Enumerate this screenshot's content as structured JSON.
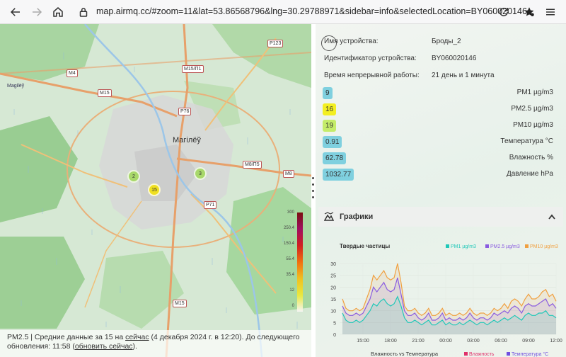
{
  "browser": {
    "url": "map.airmq.cc/#zoom=11&lat=53.86568796&lng=30.29788971&sidebar=info&selectedLocation=BY060020146",
    "icons": [
      "back-arrow-icon",
      "forward-arrow-icon",
      "home-icon",
      "lock-icon",
      "reload-icon",
      "bookmark-star-icon",
      "menu-icon"
    ]
  },
  "map": {
    "city": "Магілёў",
    "road_labels": [
      "M4",
      "M15",
      "M15/П1",
      "P123",
      "P76",
      "M8/П5",
      "M8",
      "P71",
      "M15"
    ],
    "poi_label": "Magilёў",
    "markers": [
      {
        "value": "2",
        "color": "#a8d86a"
      },
      {
        "value": "3",
        "color": "#a8d86a"
      },
      {
        "value": "15",
        "color": "#f0e020"
      }
    ],
    "scale_ticks": [
      "300",
      "250.4",
      "150.4",
      "55.4",
      "35.4",
      "12",
      "0"
    ],
    "footer": {
      "text1": "PM2.5 | Средние данные за 15 на ",
      "link1": "сейчас",
      "text2": " (4 декабря 2024 г. в 12:20). До следующего",
      "text3": "обновления: 11:58 (",
      "link2": "обновить сейчас",
      "text4": ")."
    }
  },
  "sidebar": {
    "info": [
      {
        "label": "Имя устройства:",
        "value": "Броды_2"
      },
      {
        "label": "Идентификатор устройства:",
        "value": "BY060020146"
      },
      {
        "label": "Время непрерывной работы:",
        "value": "21 день и 1 минута"
      }
    ],
    "measurements": [
      {
        "value": "9",
        "label": "PM1 µg/m3",
        "color": "#7fd0df"
      },
      {
        "value": "16",
        "label": "PM2.5 µg/m3",
        "color": "#f3ef22"
      },
      {
        "value": "19",
        "label": "PM10 µg/m3",
        "color": "#c4ec6a"
      },
      {
        "value": "0.91",
        "label": "Температура °C",
        "color": "#7fd0df"
      },
      {
        "value": "62.78",
        "label": "Влажность %",
        "color": "#7fd0df"
      },
      {
        "value": "1032.77",
        "label": "Давление hPa",
        "color": "#7fd0df"
      }
    ],
    "charts_title": "Графики"
  },
  "chart_data": [
    {
      "type": "line",
      "title": "Твердые частицы",
      "x_ticks": [
        "15:00",
        "18:00",
        "21:00",
        "00:00",
        "03:00",
        "06:00",
        "09:00",
        "12:00"
      ],
      "ylim": [
        0,
        30
      ],
      "y_ticks": [
        "0",
        "5",
        "10",
        "15",
        "20",
        "25",
        "30"
      ],
      "series": [
        {
          "name": "PM1 µg/m3",
          "color": "#20c8b8",
          "values": [
            9,
            6,
            5,
            5,
            6,
            5,
            6,
            8,
            10,
            13,
            12,
            14,
            15,
            13,
            12,
            13,
            16,
            12,
            7,
            5,
            5,
            6,
            5,
            4,
            5,
            6,
            4,
            4,
            5,
            6,
            4,
            5,
            4,
            4,
            5,
            4,
            5,
            6,
            5,
            4,
            5,
            5,
            4,
            5,
            6,
            5,
            6,
            7,
            6,
            7,
            8,
            7,
            6,
            8,
            9,
            8,
            8,
            9,
            9,
            10,
            8,
            8,
            7
          ]
        },
        {
          "name": "PM2.5 µg/m3",
          "color": "#8a5ce0",
          "values": [
            12,
            9,
            8,
            8,
            9,
            8,
            9,
            12,
            15,
            20,
            18,
            20,
            22,
            19,
            18,
            19,
            24,
            17,
            10,
            8,
            8,
            9,
            7,
            6,
            7,
            9,
            6,
            6,
            7,
            9,
            6,
            7,
            6,
            6,
            7,
            6,
            7,
            9,
            7,
            6,
            7,
            7,
            6,
            7,
            9,
            8,
            9,
            10,
            9,
            11,
            12,
            11,
            9,
            12,
            13,
            12,
            12,
            13,
            14,
            15,
            12,
            13,
            11
          ]
        },
        {
          "name": "PM10 µg/m3",
          "color": "#f0a040",
          "values": [
            15,
            11,
            10,
            10,
            11,
            10,
            11,
            15,
            19,
            25,
            23,
            25,
            27,
            24,
            23,
            24,
            30,
            22,
            12,
            10,
            10,
            11,
            9,
            8,
            9,
            11,
            8,
            8,
            9,
            11,
            8,
            9,
            8,
            8,
            9,
            8,
            9,
            11,
            9,
            8,
            9,
            9,
            8,
            9,
            11,
            10,
            11,
            13,
            11,
            14,
            15,
            14,
            12,
            15,
            17,
            15,
            15,
            16,
            18,
            19,
            16,
            17,
            14
          ]
        }
      ]
    },
    {
      "type": "line",
      "title": "Влажность vs Температура",
      "series": [
        {
          "name": "Влажность",
          "color": "#e0306a"
        },
        {
          "name": "Температура °C",
          "color": "#7050e0"
        }
      ]
    }
  ]
}
